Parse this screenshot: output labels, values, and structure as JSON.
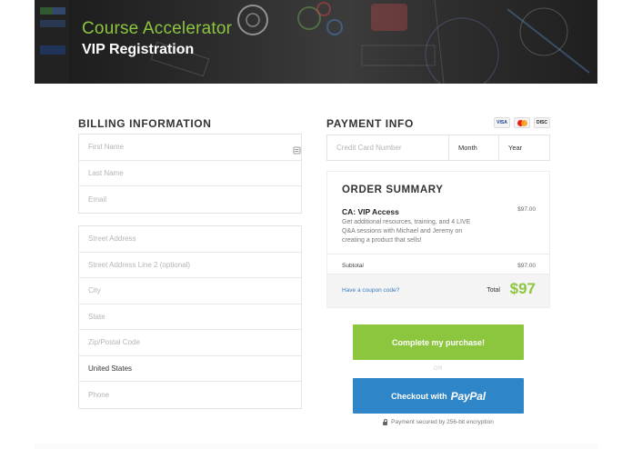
{
  "hero": {
    "title": "Course Accelerator",
    "subtitle": "VIP Registration"
  },
  "billing": {
    "heading": "BILLING INFORMATION",
    "contact_fields": [
      {
        "placeholder": "First Name"
      },
      {
        "placeholder": "Last Name"
      },
      {
        "placeholder": "Email"
      }
    ],
    "address_fields": [
      {
        "placeholder": "Street Address"
      },
      {
        "placeholder": "Street Address Line 2 (optional)"
      },
      {
        "placeholder": "City"
      },
      {
        "placeholder": "State"
      },
      {
        "placeholder": "Zip/Postal Code"
      },
      {
        "value": "United States"
      },
      {
        "placeholder": "Phone"
      }
    ]
  },
  "payment": {
    "heading": "PAYMENT INFO",
    "card_brands": [
      "VISA",
      "MC",
      "DISC"
    ],
    "cc_placeholder": "Credit Card Number",
    "month_label": "Month",
    "year_label": "Year"
  },
  "order": {
    "heading": "ORDER SUMMARY",
    "item_name": "CA: VIP Access",
    "item_description": "Get additional resources, training, and 4 LIVE Q&A sessions with Michael and Jeremy on creating a product that sells!",
    "item_price": "$97.00",
    "subtotal_label": "Subtotal",
    "subtotal_value": "$97.00",
    "coupon_link": "Have a coupon code?",
    "total_label": "Total",
    "total_value": "$97"
  },
  "actions": {
    "complete_label": "Complete my purchase!",
    "or_label": "OR",
    "paypal_prefix": "Checkout with",
    "paypal_logo": "PayPal",
    "secure_note": "Payment secured by 256-bit encryption"
  },
  "colors": {
    "accent_green": "#8cc63f",
    "paypal_blue": "#2e85c7",
    "link_blue": "#3b7dbf"
  }
}
